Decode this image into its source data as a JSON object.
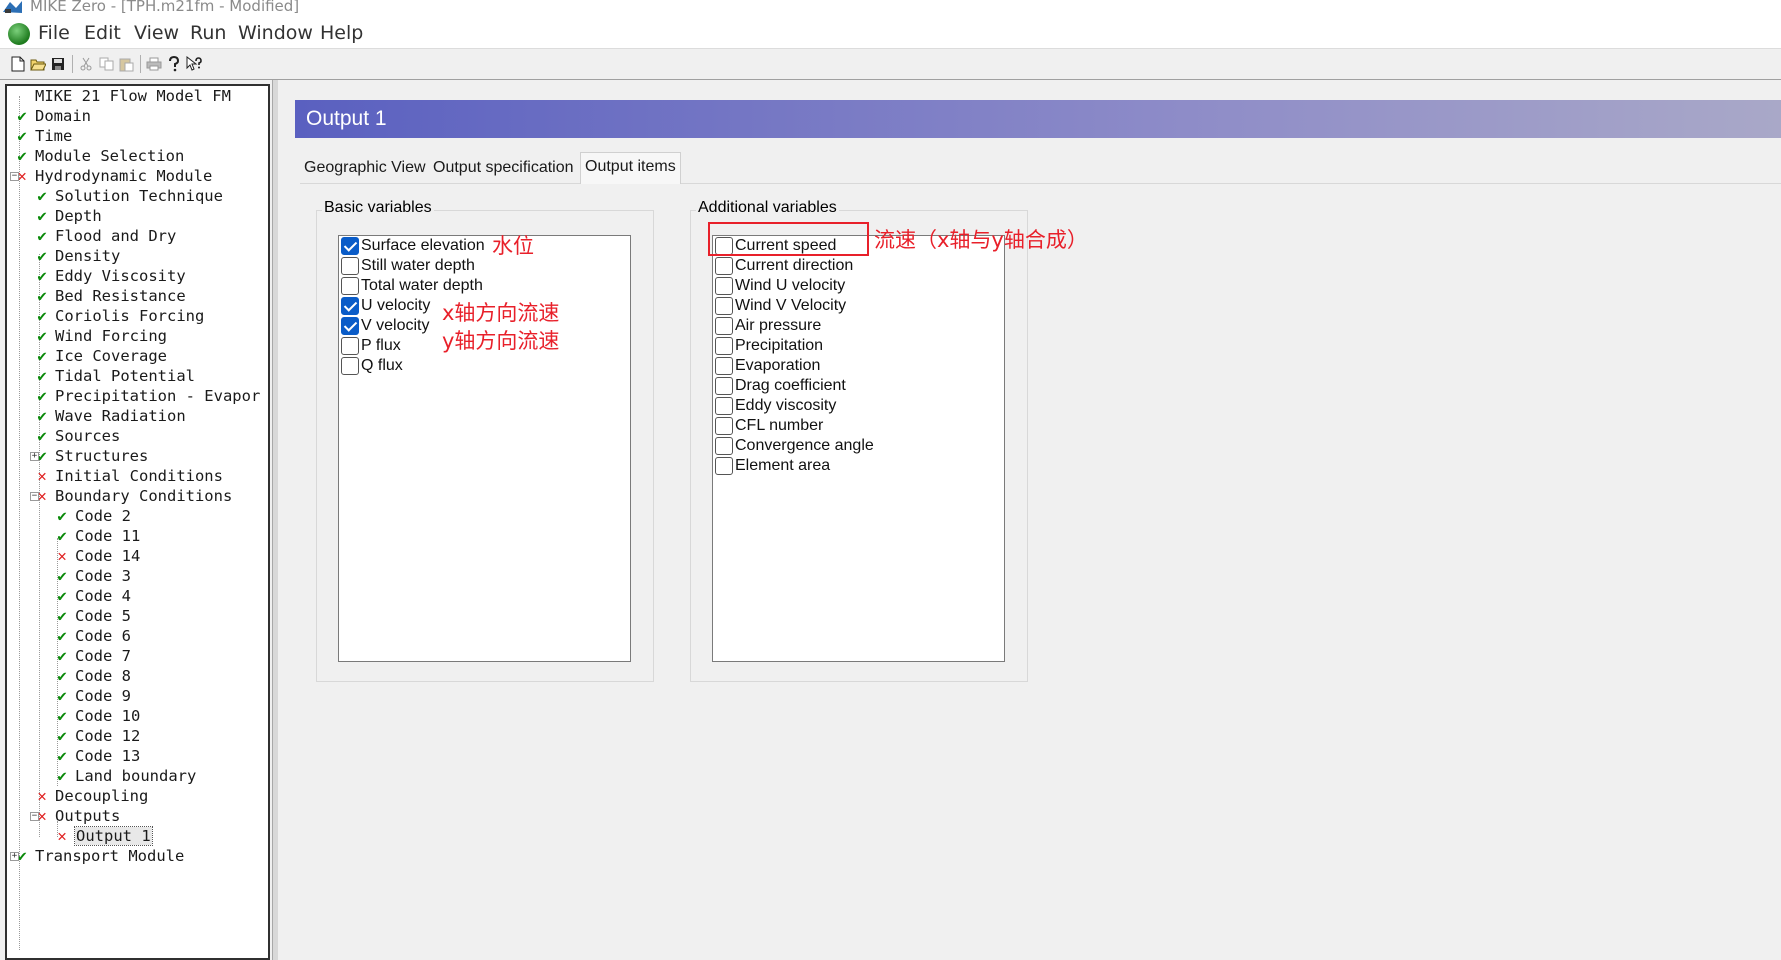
{
  "window": {
    "title": "MIKE Zero - [TPH.m21fm - Modified]"
  },
  "menu": [
    "File",
    "Edit",
    "View",
    "Run",
    "Window",
    "Help"
  ],
  "toolbar": {
    "buttons": [
      "new-file-icon",
      "open-folder-icon",
      "save-icon",
      "cut-icon",
      "copy-icon",
      "paste-icon",
      "print-icon",
      "help-icon",
      "context-help-icon"
    ]
  },
  "tree": [
    {
      "label": "MIKE 21 Flow Model FM",
      "level": 0,
      "status": "none",
      "expander": "none"
    },
    {
      "label": "Domain",
      "level": 1,
      "status": "ok",
      "expander": "none"
    },
    {
      "label": "Time",
      "level": 1,
      "status": "ok",
      "expander": "none"
    },
    {
      "label": "Module Selection",
      "level": 1,
      "status": "ok",
      "expander": "none"
    },
    {
      "label": "Hydrodynamic Module",
      "level": 1,
      "status": "err",
      "expander": "minus"
    },
    {
      "label": "Solution Technique",
      "level": 2,
      "status": "ok",
      "expander": "none"
    },
    {
      "label": "Depth",
      "level": 2,
      "status": "ok",
      "expander": "none"
    },
    {
      "label": "Flood and Dry",
      "level": 2,
      "status": "ok",
      "expander": "none"
    },
    {
      "label": "Density",
      "level": 2,
      "status": "ok",
      "expander": "none"
    },
    {
      "label": "Eddy Viscosity",
      "level": 2,
      "status": "ok",
      "expander": "none"
    },
    {
      "label": "Bed Resistance",
      "level": 2,
      "status": "ok",
      "expander": "none"
    },
    {
      "label": "Coriolis Forcing",
      "level": 2,
      "status": "ok",
      "expander": "none"
    },
    {
      "label": "Wind Forcing",
      "level": 2,
      "status": "ok",
      "expander": "none"
    },
    {
      "label": "Ice Coverage",
      "level": 2,
      "status": "ok",
      "expander": "none"
    },
    {
      "label": "Tidal Potential",
      "level": 2,
      "status": "ok",
      "expander": "none"
    },
    {
      "label": "Precipitation - Evapor",
      "level": 2,
      "status": "ok",
      "expander": "none"
    },
    {
      "label": "Wave Radiation",
      "level": 2,
      "status": "ok",
      "expander": "none"
    },
    {
      "label": "Sources",
      "level": 2,
      "status": "ok",
      "expander": "none"
    },
    {
      "label": "Structures",
      "level": 2,
      "status": "ok",
      "expander": "plus"
    },
    {
      "label": "Initial Conditions",
      "level": 2,
      "status": "err",
      "expander": "none"
    },
    {
      "label": "Boundary Conditions",
      "level": 2,
      "status": "err",
      "expander": "minus"
    },
    {
      "label": "Code 2",
      "level": 3,
      "status": "ok",
      "expander": "none"
    },
    {
      "label": "Code 11",
      "level": 3,
      "status": "ok",
      "expander": "none"
    },
    {
      "label": "Code 14",
      "level": 3,
      "status": "err",
      "expander": "none"
    },
    {
      "label": "Code 3",
      "level": 3,
      "status": "ok",
      "expander": "none"
    },
    {
      "label": "Code 4",
      "level": 3,
      "status": "ok",
      "expander": "none"
    },
    {
      "label": "Code 5",
      "level": 3,
      "status": "ok",
      "expander": "none"
    },
    {
      "label": "Code 6",
      "level": 3,
      "status": "ok",
      "expander": "none"
    },
    {
      "label": "Code 7",
      "level": 3,
      "status": "ok",
      "expander": "none"
    },
    {
      "label": "Code 8",
      "level": 3,
      "status": "ok",
      "expander": "none"
    },
    {
      "label": "Code 9",
      "level": 3,
      "status": "ok",
      "expander": "none"
    },
    {
      "label": "Code 10",
      "level": 3,
      "status": "ok",
      "expander": "none"
    },
    {
      "label": "Code 12",
      "level": 3,
      "status": "ok",
      "expander": "none"
    },
    {
      "label": "Code 13",
      "level": 3,
      "status": "ok",
      "expander": "none"
    },
    {
      "label": "Land boundary",
      "level": 3,
      "status": "ok",
      "expander": "none"
    },
    {
      "label": "Decoupling",
      "level": 2,
      "status": "err",
      "expander": "none"
    },
    {
      "label": "Outputs",
      "level": 2,
      "status": "err",
      "expander": "minus"
    },
    {
      "label": "Output 1",
      "level": 3,
      "status": "err",
      "expander": "none",
      "selected": true
    },
    {
      "label": "Transport Module",
      "level": 1,
      "status": "ok",
      "expander": "plus"
    }
  ],
  "panel": {
    "title": "Output 1",
    "tabs": [
      {
        "label": "Geographic View",
        "active": false
      },
      {
        "label": "Output specification",
        "active": false
      },
      {
        "label": "Output items",
        "active": true
      }
    ]
  },
  "basic_variables": {
    "title": "Basic variables",
    "items": [
      {
        "label": "Surface elevation",
        "checked": true
      },
      {
        "label": "Still water depth",
        "checked": false
      },
      {
        "label": "Total water depth",
        "checked": false
      },
      {
        "label": "U velocity",
        "checked": true
      },
      {
        "label": "V velocity",
        "checked": true
      },
      {
        "label": "P flux",
        "checked": false
      },
      {
        "label": "Q flux",
        "checked": false
      }
    ]
  },
  "additional_variables": {
    "title": "Additional variables",
    "items": [
      {
        "label": "Current speed",
        "checked": false
      },
      {
        "label": "Current direction",
        "checked": false
      },
      {
        "label": "Wind U velocity",
        "checked": false
      },
      {
        "label": "Wind V Velocity",
        "checked": false
      },
      {
        "label": "Air pressure",
        "checked": false
      },
      {
        "label": "Precipitation",
        "checked": false
      },
      {
        "label": "Evaporation",
        "checked": false
      },
      {
        "label": "Drag coefficient",
        "checked": false
      },
      {
        "label": "Eddy viscosity",
        "checked": false
      },
      {
        "label": "CFL number",
        "checked": false
      },
      {
        "label": "Convergence angle",
        "checked": false
      },
      {
        "label": "Element area",
        "checked": false
      }
    ]
  },
  "annotations": {
    "surface_elevation": "水位",
    "u_velocity": "x轴方向流速",
    "v_velocity": "y轴方向流速",
    "current_speed": "流速（x轴与y轴合成）"
  },
  "colors": {
    "ok_mark": "#0a8a0a",
    "err_mark": "#e02020",
    "checkbox_checked": "#0a5cc8",
    "annotation": "#e8202a",
    "header_gradient_start": "#5a60c0"
  }
}
